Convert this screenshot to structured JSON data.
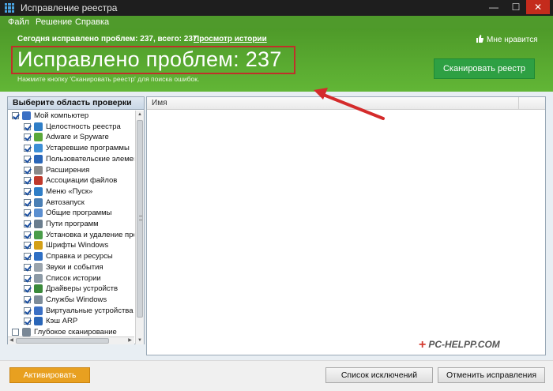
{
  "window": {
    "title": "Исправление реестра",
    "min": "—",
    "max": "☐",
    "close": "✕"
  },
  "menu": [
    {
      "label": "Файл"
    },
    {
      "label": "Решение"
    },
    {
      "label": "Справка"
    }
  ],
  "header": {
    "summary": "Сегодня исправлено проблем: 237, всего: 237.",
    "history_link": "Просмотр истории",
    "like": "Мне нравится",
    "big_title": "Исправлено проблем: 237",
    "hint": "Нажмите кнопку 'Сканировать реестр' для поиска ошибок.",
    "scan_button": "Сканировать реестр"
  },
  "left_panel": {
    "title": "Выберите область проверки",
    "items": [
      {
        "label": "Мой компьютер",
        "checked": true,
        "level": 0,
        "icon": "computer-icon",
        "color": "#3a6fc4"
      },
      {
        "label": "Целостность реестра",
        "checked": true,
        "level": 1,
        "icon": "registry-icon",
        "color": "#2f7ec7"
      },
      {
        "label": "Adware и Spyware",
        "checked": true,
        "level": 1,
        "icon": "bug-icon",
        "color": "#5aa83a"
      },
      {
        "label": "Устаревшие программы",
        "checked": true,
        "level": 1,
        "icon": "program-icon",
        "color": "#3d8fd6"
      },
      {
        "label": "Пользовательские элемен",
        "checked": true,
        "level": 1,
        "icon": "users-icon",
        "color": "#2a66b8"
      },
      {
        "label": "Расширения",
        "checked": true,
        "level": 1,
        "icon": "extension-icon",
        "color": "#8a8a8a"
      },
      {
        "label": "Ассоциации файлов",
        "checked": true,
        "level": 1,
        "icon": "file-assoc-icon",
        "color": "#c0392b"
      },
      {
        "label": "Меню «Пуск»",
        "checked": true,
        "level": 1,
        "icon": "start-menu-icon",
        "color": "#2f7ec7"
      },
      {
        "label": "Автозапуск",
        "checked": true,
        "level": 1,
        "icon": "autorun-icon",
        "color": "#4a7fb5"
      },
      {
        "label": "Общие программы",
        "checked": true,
        "level": 1,
        "icon": "shared-programs-icon",
        "color": "#5b8fd0"
      },
      {
        "label": "Пути программ",
        "checked": true,
        "level": 1,
        "icon": "program-paths-icon",
        "color": "#6a7d8e"
      },
      {
        "label": "Установка и удаление про",
        "checked": true,
        "level": 1,
        "icon": "install-icon",
        "color": "#4a9d4a"
      },
      {
        "label": "Шрифты Windows",
        "checked": true,
        "level": 1,
        "icon": "fonts-icon",
        "color": "#d4a017"
      },
      {
        "label": "Справка и ресурсы",
        "checked": true,
        "level": 1,
        "icon": "help-icon",
        "color": "#2f6fc4"
      },
      {
        "label": "Звуки и события",
        "checked": true,
        "level": 1,
        "icon": "sound-icon",
        "color": "#9aa4ad"
      },
      {
        "label": "Список истории",
        "checked": true,
        "level": 1,
        "icon": "history-icon",
        "color": "#8c9aa6"
      },
      {
        "label": "Драйверы устройств",
        "checked": true,
        "level": 1,
        "icon": "driver-icon",
        "color": "#3a8a3a"
      },
      {
        "label": "Службы Windows",
        "checked": true,
        "level": 1,
        "icon": "services-icon",
        "color": "#7d8c99"
      },
      {
        "label": "Виртуальные устройства",
        "checked": true,
        "level": 1,
        "icon": "virtual-device-icon",
        "color": "#3a6fc4"
      },
      {
        "label": "Кэш ARP",
        "checked": true,
        "level": 1,
        "icon": "arp-cache-icon",
        "color": "#2a66b8"
      },
      {
        "label": "Глубокое сканирование",
        "checked": false,
        "level": 0,
        "icon": "deep-scan-icon",
        "color": "#7a8896"
      }
    ]
  },
  "results": {
    "column_name": "Имя"
  },
  "watermark": {
    "plus": "+",
    "text": "PC-HELPP.COM"
  },
  "footer": {
    "activate": "Активировать",
    "exclusions": "Список исключений",
    "undo": "Отменить исправления"
  }
}
